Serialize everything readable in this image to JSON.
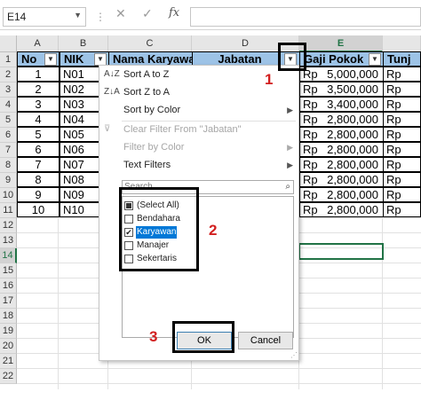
{
  "formula_bar": {
    "cell_ref": "E14",
    "cancel_icon": "✕",
    "enter_icon": "✓",
    "fx": "fx"
  },
  "columns": [
    "A",
    "B",
    "C",
    "D",
    "E"
  ],
  "rows": [
    "1",
    "2",
    "3",
    "4",
    "5",
    "6",
    "7",
    "8",
    "9",
    "10",
    "11",
    "12",
    "13",
    "14",
    "15",
    "16",
    "17",
    "18",
    "19",
    "20",
    "21",
    "22"
  ],
  "headers": {
    "no": "No",
    "nik": "NIK",
    "nama": "Nama Karyawa",
    "jabatan": "Jabatan",
    "gaji": "Gaji Pokok",
    "tunj": "Tunj"
  },
  "table": [
    {
      "no": "1",
      "nik": "N01",
      "rp": "Rp",
      "gaji": "5,000,000",
      "rp2": "Rp"
    },
    {
      "no": "2",
      "nik": "N02",
      "rp": "Rp",
      "gaji": "3,500,000",
      "rp2": "Rp"
    },
    {
      "no": "3",
      "nik": "N03",
      "rp": "Rp",
      "gaji": "3,400,000",
      "rp2": "Rp"
    },
    {
      "no": "4",
      "nik": "N04",
      "rp": "Rp",
      "gaji": "2,800,000",
      "rp2": "Rp"
    },
    {
      "no": "5",
      "nik": "N05",
      "rp": "Rp",
      "gaji": "2,800,000",
      "rp2": "Rp"
    },
    {
      "no": "6",
      "nik": "N06",
      "rp": "Rp",
      "gaji": "2,800,000",
      "rp2": "Rp"
    },
    {
      "no": "7",
      "nik": "N07",
      "rp": "Rp",
      "gaji": "2,800,000",
      "rp2": "Rp"
    },
    {
      "no": "8",
      "nik": "N08",
      "rp": "Rp",
      "gaji": "2,800,000",
      "rp2": "Rp"
    },
    {
      "no": "9",
      "nik": "N09",
      "rp": "Rp",
      "gaji": "2,800,000",
      "rp2": "Rp"
    },
    {
      "no": "10",
      "nik": "N10",
      "rp": "Rp",
      "gaji": "2,800,000",
      "rp2": "Rp"
    }
  ],
  "filter_menu": {
    "sort_az": "Sort A to Z",
    "sort_za": "Sort Z to A",
    "sort_color": "Sort by Color",
    "clear_filter": "Clear Filter From \"Jabatan\"",
    "filter_color": "Filter by Color",
    "text_filters": "Text Filters",
    "search_placeholder": "Search",
    "items": [
      {
        "label": "(Select All)",
        "state": "partial"
      },
      {
        "label": "Bendahara",
        "state": "unchecked"
      },
      {
        "label": "Karyawan",
        "state": "checked"
      },
      {
        "label": "Manajer",
        "state": "unchecked"
      },
      {
        "label": "Sekertaris",
        "state": "unchecked"
      }
    ],
    "ok": "OK",
    "cancel": "Cancel"
  },
  "annotations": {
    "step1": "1",
    "step2": "2",
    "step3": "3"
  },
  "colors": {
    "header_fill": "#9dc3e6",
    "annotation_red": "#d21f1f",
    "excel_green": "#217346"
  }
}
